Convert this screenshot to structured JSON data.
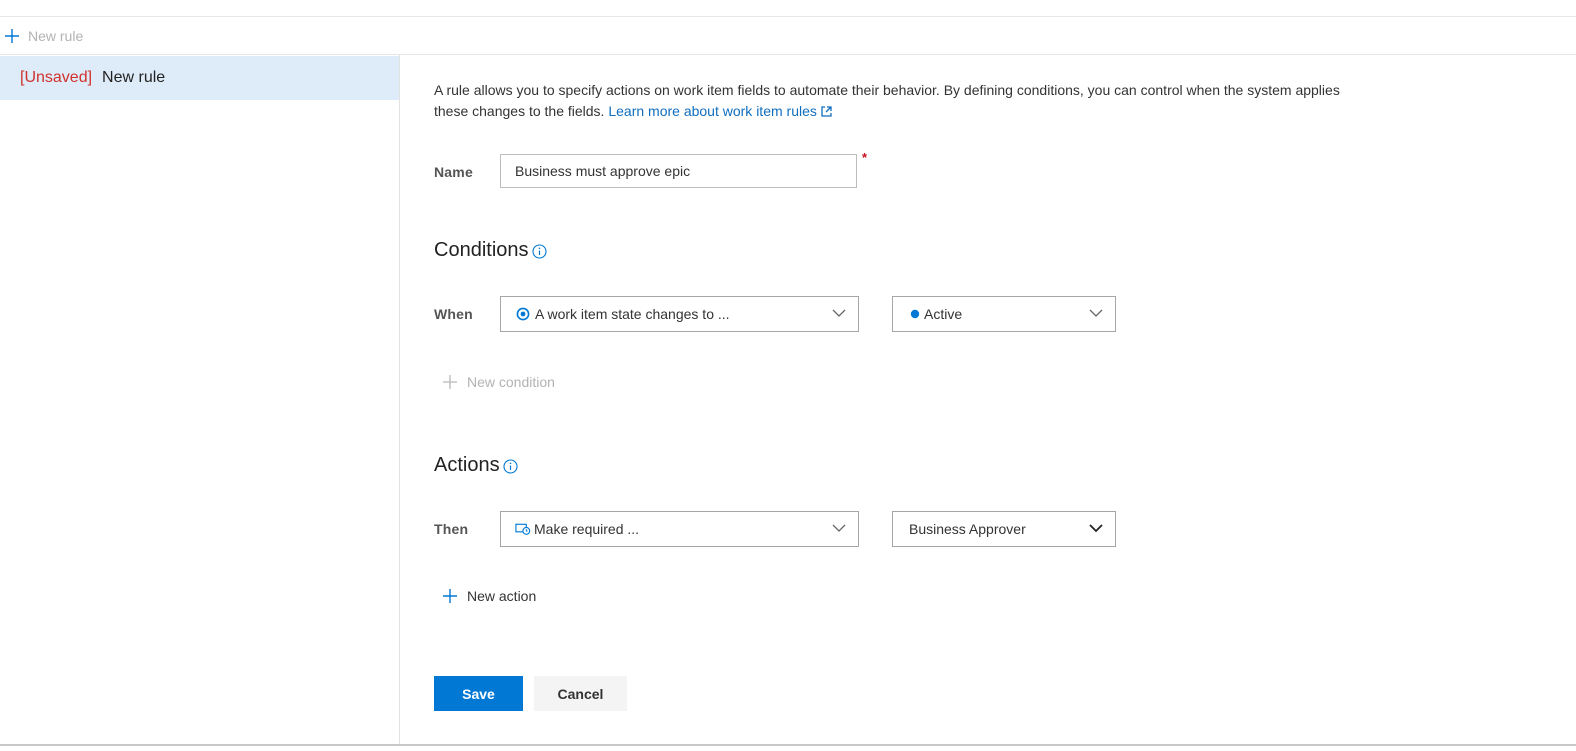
{
  "toolbar": {
    "new_rule_label": "New rule"
  },
  "rules_list": [
    {
      "status": "[Unsaved]",
      "name": "New rule",
      "selected": true
    }
  ],
  "description": {
    "text": "A rule allows you to specify actions on work item fields to automate their behavior. By defining conditions, you can control when the system applies these changes to the fields.",
    "link_text": "Learn more about work item rules"
  },
  "name_field": {
    "label": "Name",
    "value": "Business must approve epic",
    "required_marker": "*"
  },
  "conditions": {
    "title": "Conditions",
    "row_label": "When",
    "trigger": {
      "value": "A work item state changes to ...",
      "icon": "state-change-icon"
    },
    "state": {
      "value": "Active",
      "dot_color": "#0078d4"
    },
    "add_label": "New condition"
  },
  "actions": {
    "title": "Actions",
    "row_label": "Then",
    "action": {
      "value": "Make required ...",
      "icon": "make-required-icon"
    },
    "field": {
      "value": "Business Approver"
    },
    "add_label": "New action"
  },
  "buttons": {
    "save": "Save",
    "cancel": "Cancel"
  },
  "colors": {
    "accent": "#0078d4",
    "unsaved": "#d0312d",
    "selected_bg": "#deecf9",
    "link": "#106ebe"
  }
}
